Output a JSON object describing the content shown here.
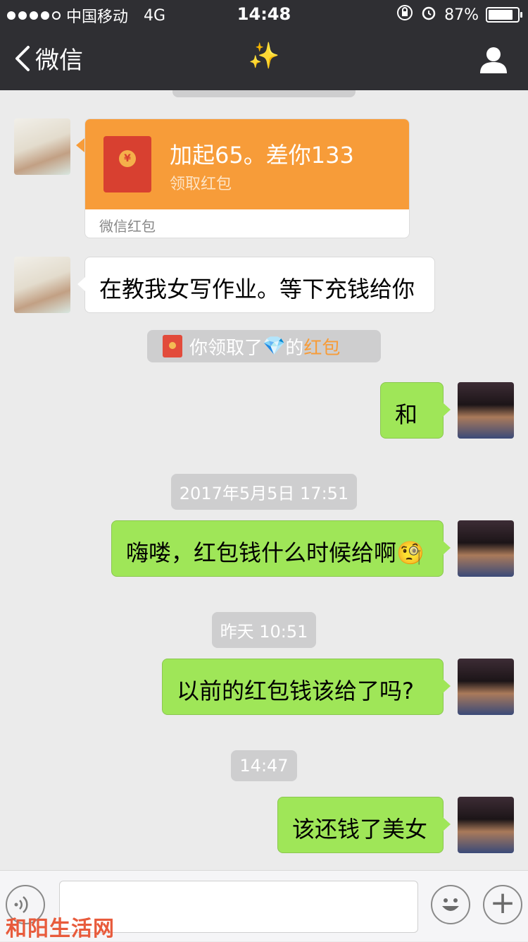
{
  "status_bar": {
    "carrier": "中国移动",
    "network": "4G",
    "time": "14:48",
    "battery": "87%"
  },
  "navbar": {
    "back_label": "微信",
    "title": "✨"
  },
  "messages": {
    "red_packet": {
      "title": "加起65。差你133",
      "subtitle": "领取红包",
      "footer": "微信红包"
    },
    "incoming_text": "在教我女写作业。等下充钱给你",
    "system_notice": {
      "prefix": "你领取了",
      "gem": "💎",
      "middle": "的",
      "link": "红包"
    },
    "msg1": "和",
    "timestamp1": "2017年5月5日 17:51",
    "msg2": "嗨喽，红包钱什么时候给啊🧐",
    "timestamp2": "昨天 10:51",
    "msg3": "以前的红包钱该给了吗?",
    "timestamp3": "14:47",
    "msg4": "该还钱了美女"
  },
  "watermark": "和阳生活网",
  "colors": {
    "nav_bg": "#2f2f33",
    "chat_bg": "#ebebeb",
    "red_packet": "#f79c39",
    "outgoing_bubble": "#9fe658"
  }
}
